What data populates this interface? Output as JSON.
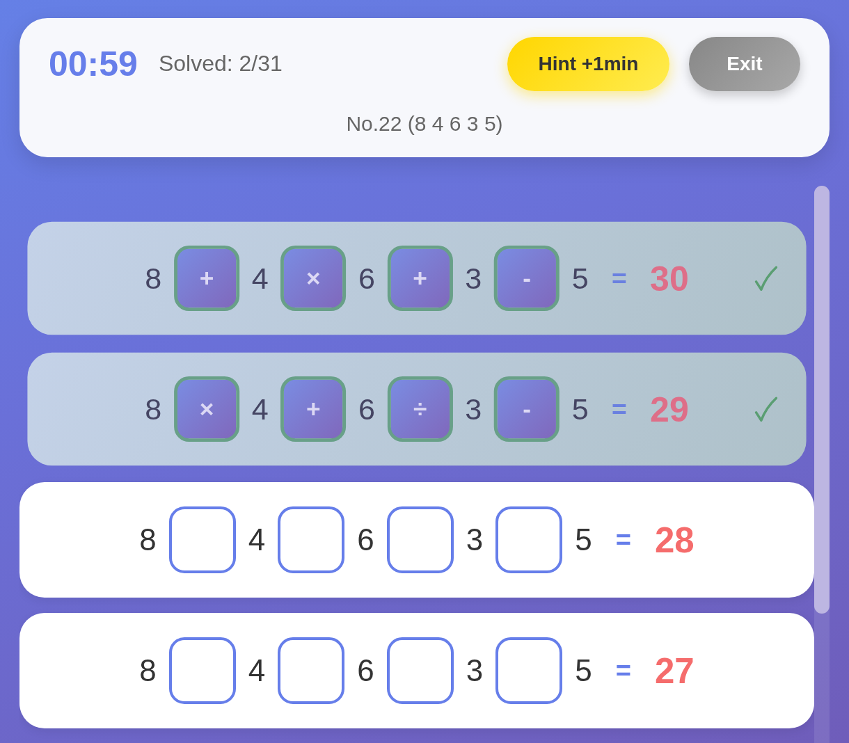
{
  "header": {
    "timer": "00:59",
    "solved": "Solved: 2/31",
    "buttons": [
      {
        "kind": "hint",
        "label": "Hint +1min"
      },
      {
        "kind": "exit",
        "label": "Exit"
      }
    ],
    "puzzle": "No.22 (8 4 6 3 5)"
  },
  "equations": [
    {
      "solved": true,
      "tokens": [
        {
          "kind": "number",
          "text": "8"
        },
        {
          "kind": "slot",
          "op": "+"
        },
        {
          "kind": "number",
          "text": "4"
        },
        {
          "kind": "slot",
          "op": "×"
        },
        {
          "kind": "number",
          "text": "6"
        },
        {
          "kind": "slot",
          "op": "+"
        },
        {
          "kind": "number",
          "text": "3"
        },
        {
          "kind": "slot",
          "op": "-"
        },
        {
          "kind": "number",
          "text": "5"
        }
      ],
      "equals": "=",
      "target": "30"
    },
    {
      "solved": true,
      "tokens": [
        {
          "kind": "number",
          "text": "8"
        },
        {
          "kind": "slot",
          "op": "×"
        },
        {
          "kind": "number",
          "text": "4"
        },
        {
          "kind": "slot",
          "op": "+"
        },
        {
          "kind": "number",
          "text": "6"
        },
        {
          "kind": "slot",
          "op": "÷"
        },
        {
          "kind": "number",
          "text": "3"
        },
        {
          "kind": "slot",
          "op": "-"
        },
        {
          "kind": "number",
          "text": "5"
        }
      ],
      "equals": "=",
      "target": "29"
    },
    {
      "solved": false,
      "tokens": [
        {
          "kind": "number",
          "text": "8"
        },
        {
          "kind": "slot"
        },
        {
          "kind": "number",
          "text": "4"
        },
        {
          "kind": "slot"
        },
        {
          "kind": "number",
          "text": "6"
        },
        {
          "kind": "slot"
        },
        {
          "kind": "number",
          "text": "3"
        },
        {
          "kind": "slot"
        },
        {
          "kind": "number",
          "text": "5"
        }
      ],
      "equals": "=",
      "target": "28"
    },
    {
      "solved": false,
      "tokens": [
        {
          "kind": "number",
          "text": "8"
        },
        {
          "kind": "slot"
        },
        {
          "kind": "number",
          "text": "4"
        },
        {
          "kind": "slot"
        },
        {
          "kind": "number",
          "text": "6"
        },
        {
          "kind": "slot"
        },
        {
          "kind": "number",
          "text": "3"
        },
        {
          "kind": "slot"
        },
        {
          "kind": "number",
          "text": "5"
        }
      ],
      "equals": "=",
      "target": "27"
    }
  ]
}
